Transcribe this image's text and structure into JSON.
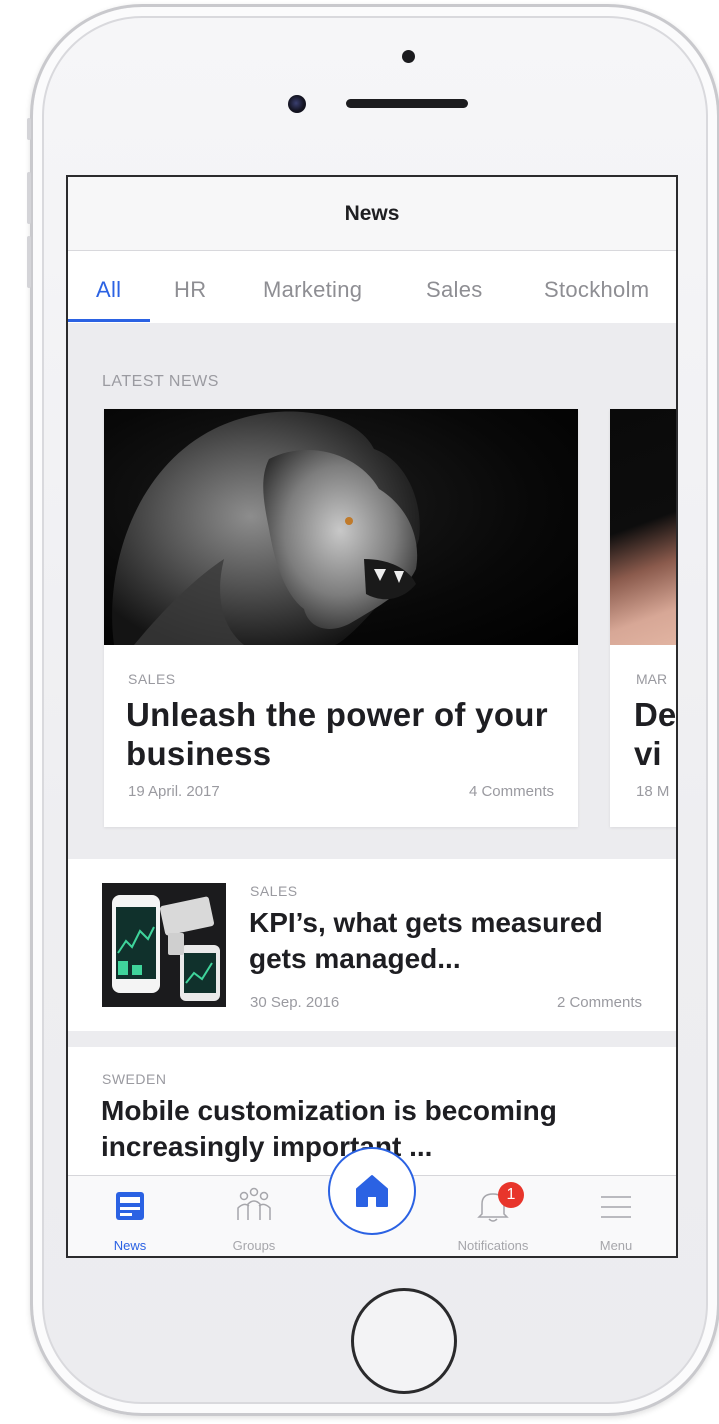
{
  "screen": {
    "title": "News"
  },
  "tabs": [
    {
      "label": "All",
      "active": true
    },
    {
      "label": "HR",
      "active": false
    },
    {
      "label": "Marketing",
      "active": false
    },
    {
      "label": "Sales",
      "active": false
    },
    {
      "label": "Stockholm",
      "active": false
    }
  ],
  "latest_news": {
    "section_label": "LATEST NEWS",
    "cards": [
      {
        "category": "SALES",
        "title": "Unleash the power of your business",
        "date": "19 April. 2017",
        "comments": "4 Comments"
      },
      {
        "category": "MAR",
        "title_line1": "De",
        "title_line2": "vi",
        "date": "18 M"
      }
    ]
  },
  "articles": [
    {
      "category": "SALES",
      "title": "KPI’s, what gets measured gets managed...",
      "date": "30 Sep. 2016",
      "comments": "2 Comments"
    },
    {
      "category": "SWEDEN",
      "title": "Mobile customization is becoming increasingly important ..."
    }
  ],
  "tabbar": {
    "items": [
      {
        "label": "News",
        "icon": "news-icon",
        "active": true
      },
      {
        "label": "Groups",
        "icon": "groups-icon",
        "active": false
      },
      {
        "label": "",
        "icon": "home-icon",
        "active": false
      },
      {
        "label": "Notifications",
        "icon": "bell-icon",
        "active": false
      },
      {
        "label": "Menu",
        "icon": "menu-icon",
        "active": false
      }
    ],
    "notification_count": "1"
  },
  "colors": {
    "accent": "#2b62e3",
    "badge": "#e8352b",
    "text": "#1e1e22",
    "muted": "#9a9aa0"
  }
}
